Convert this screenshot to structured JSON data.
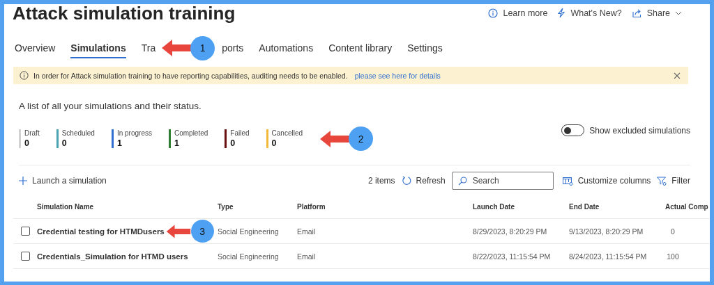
{
  "page": {
    "title": "Attack simulation training"
  },
  "header_actions": [
    {
      "kind": "info",
      "label": "Learn more"
    },
    {
      "kind": "bolt",
      "label": "What's New?"
    },
    {
      "kind": "share",
      "label": "Share"
    }
  ],
  "tabs": [
    {
      "label": "Overview",
      "selected": false
    },
    {
      "label": "Simulations",
      "selected": true
    },
    {
      "label": "Tra",
      "selected": false
    },
    {
      "label": "ports",
      "selected": false
    },
    {
      "label": "Automations",
      "selected": false
    },
    {
      "label": "Content library",
      "selected": false
    },
    {
      "label": "Settings",
      "selected": false
    }
  ],
  "banner": {
    "message": "In order for Attack simulation training to have reporting capabilities, auditing needs to be enabled.",
    "link": "please see here for details"
  },
  "description": "A list of all your simulations and their status.",
  "stats": [
    {
      "label": "Draft",
      "value": "0",
      "color": "#d2d2d2"
    },
    {
      "label": "Scheduled",
      "value": "0",
      "color": "#4aa3b0"
    },
    {
      "label": "In progress",
      "value": "1",
      "color": "#2f6fcf"
    },
    {
      "label": "Completed",
      "value": "1",
      "color": "#2e7d32"
    },
    {
      "label": "Failed",
      "value": "0",
      "color": "#6b1010"
    },
    {
      "label": "Cancelled",
      "value": "0",
      "color": "#f2b936"
    }
  ],
  "excluded_toggle": {
    "label": "Show excluded simulations",
    "on": false
  },
  "toolbar": {
    "launch": "Launch a simulation",
    "count": "2 items",
    "refresh": "Refresh",
    "search_placeholder": "Search",
    "customize": "Customize columns",
    "filter": "Filter"
  },
  "table": {
    "columns": [
      "Simulation Name",
      "Type",
      "Platform",
      "Launch Date",
      "End Date",
      "Actual Comp"
    ],
    "rows": [
      {
        "checked": false,
        "cells": [
          "Credential testing for HTMDusers",
          "Social Engineering",
          "Email",
          "8/29/2023, 8:20:29 PM",
          "9/13/2023, 8:20:29 PM",
          "0"
        ]
      },
      {
        "checked": false,
        "cells": [
          "Credentials_Simulation for HTMD users",
          "Social Engineering",
          "Email",
          "8/22/2023, 11:15:54 PM",
          "8/24/2023, 11:15:54 PM",
          "100"
        ]
      }
    ]
  },
  "annotations": [
    {
      "number": "1"
    },
    {
      "number": "2"
    },
    {
      "number": "3"
    }
  ]
}
